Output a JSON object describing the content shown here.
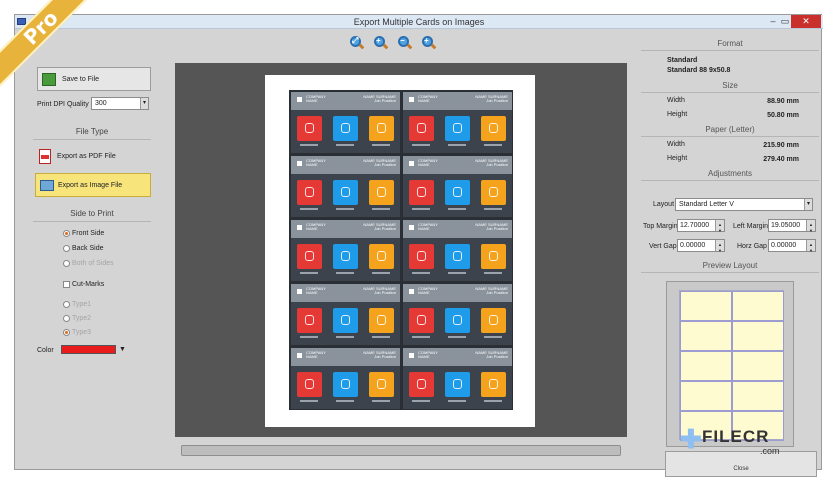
{
  "window": {
    "title": "Export Multiple Cards on Images",
    "minimize_glyph": "–",
    "maximize_glyph": "▭",
    "close_glyph": "✕"
  },
  "badge": {
    "text": "Pro"
  },
  "left": {
    "save_label": "Save to File",
    "dpi_label": "Print DPI Quality",
    "dpi_value": "300",
    "file_type_heading": "File Type",
    "export_pdf_label": "Export as PDF File",
    "export_image_label": "Export as Image File",
    "side_heading": "Side to Print",
    "sides": [
      {
        "label": "Front Side",
        "checked": true,
        "enabled": true
      },
      {
        "label": "Back Side",
        "checked": false,
        "enabled": true
      },
      {
        "label": "Both of Sides",
        "checked": false,
        "enabled": false
      }
    ],
    "cut_marks_label": "Cut-Marks",
    "types": [
      {
        "label": "Type1",
        "checked": false
      },
      {
        "label": "Type2",
        "checked": false
      },
      {
        "label": "Type3",
        "checked": true
      }
    ],
    "color_label": "Color",
    "color_value": "#e81c1c"
  },
  "card": {
    "company": "COMPANY",
    "company_sub": "NAME",
    "name": "NAME SURNAME",
    "title": "Job Position"
  },
  "right": {
    "format_heading": "Format",
    "format_name": "Standard",
    "format_detail": "Standard 88 9x50.8",
    "size_heading": "Size",
    "width_label": "Width",
    "width_value": "88.90 mm",
    "height_label": "Height",
    "height_value": "50.80 mm",
    "paper_heading": "Paper (Letter)",
    "paper_width_label": "Width",
    "paper_width_value": "215.90 mm",
    "paper_height_label": "Height",
    "paper_height_value": "279.40 mm",
    "adjust_heading": "Adjustments",
    "layout_label": "Layout",
    "layout_value": "Standard Letter V",
    "top_margin_label": "Top Margin",
    "top_margin_value": "12.70000",
    "left_margin_label": "Left Margin",
    "left_margin_value": "19.05000",
    "vert_gap_label": "Vert Gap",
    "vert_gap_value": "0.00000",
    "horz_gap_label": "Horz Gap",
    "horz_gap_value": "0.00000",
    "preview_heading": "Preview Layout",
    "close_label": "Close"
  },
  "watermark": {
    "brand": "FILECR",
    "suffix": ".com"
  },
  "icons": [
    "zoom-fit-icon",
    "zoom-in-icon",
    "zoom-out-icon",
    "zoom-reset-icon",
    "save-icon",
    "pdf-icon",
    "image-icon"
  ]
}
